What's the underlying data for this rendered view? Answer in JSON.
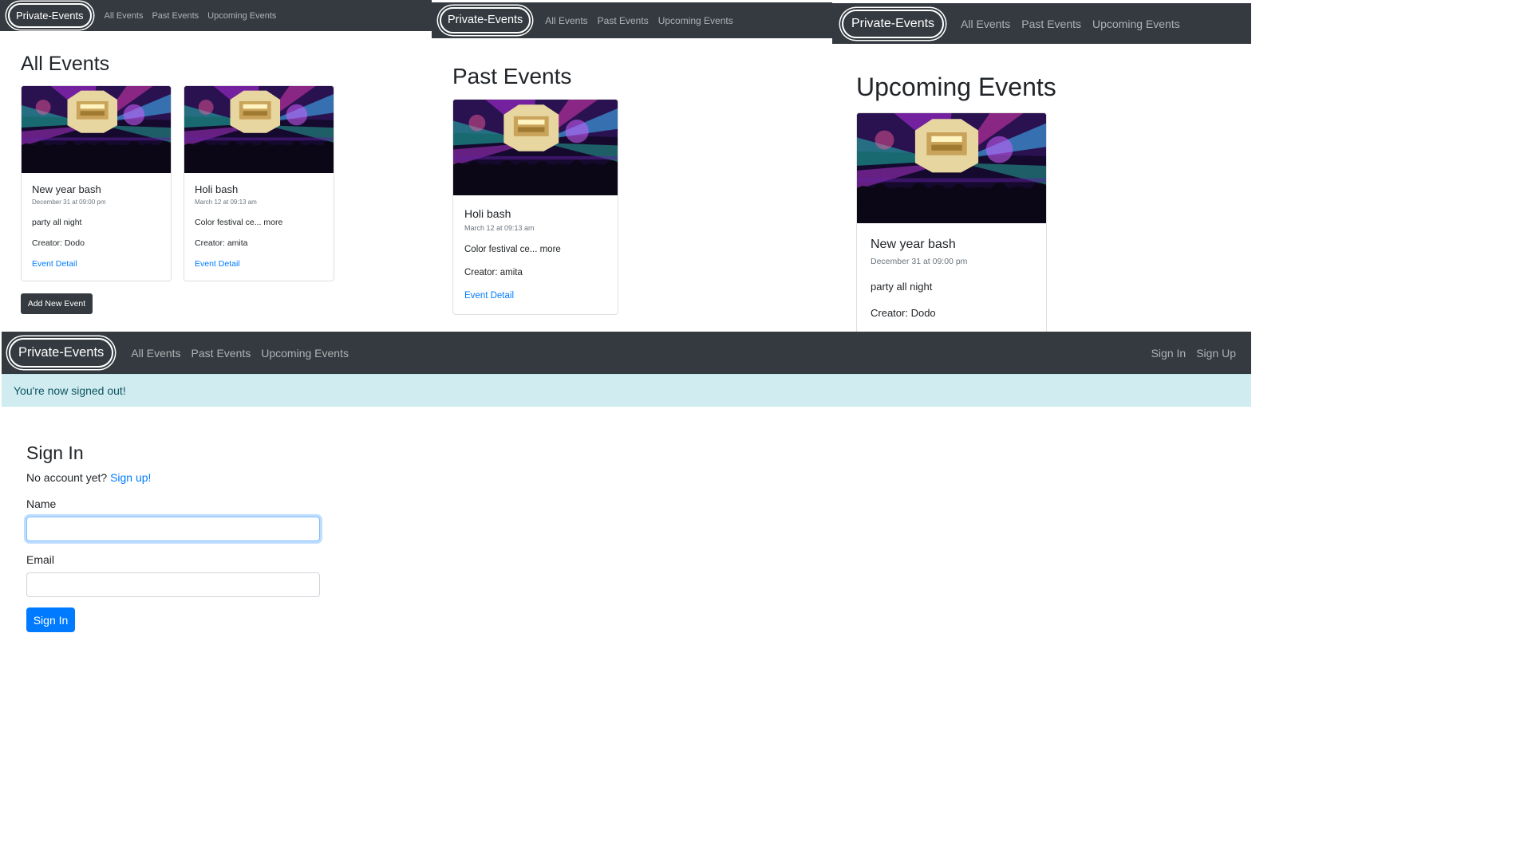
{
  "brand": "Private-Events",
  "nav_links": [
    "All Events",
    "Past Events",
    "Upcoming Events"
  ],
  "auth_links": [
    "Sign In",
    "Sign Up"
  ],
  "all_events": {
    "heading": "All Events",
    "events": [
      {
        "title": "New year bash",
        "date": "December 31 at 09:00 pm",
        "description": "party all night",
        "creator": "Creator: Dodo",
        "link": "Event Detail"
      },
      {
        "title": "Holi bash",
        "date": "March 12 at 09:13 am",
        "description": "Color festival ce... more",
        "creator": "Creator: amita",
        "link": "Event Detail"
      }
    ],
    "add_button": "Add New Event"
  },
  "past_events": {
    "heading": "Past Events",
    "events": [
      {
        "title": "Holi bash",
        "date": "March 12 at 09:13 am",
        "description": "Color festival ce... more",
        "creator": "Creator: amita",
        "link": "Event Detail"
      }
    ]
  },
  "upcoming_events": {
    "heading": "Upcoming Events",
    "events": [
      {
        "title": "New year bash",
        "date": "December 31 at 09:00 pm",
        "description": "party all night",
        "creator": "Creator: Dodo"
      }
    ]
  },
  "signin": {
    "alert": "You're now signed out!",
    "heading": "Sign In",
    "no_account": "No account yet?",
    "signup_link": "Sign up!",
    "name_label": "Name",
    "name_value": "",
    "email_label": "Email",
    "email_value": "",
    "submit": "Sign In"
  },
  "colors": {
    "navbar": "#343a40",
    "link": "#007bff",
    "alert_bg": "#d1ecf1",
    "alert_text": "#0c5460"
  },
  "icons": {
    "event_image": "concert-stage-image"
  }
}
